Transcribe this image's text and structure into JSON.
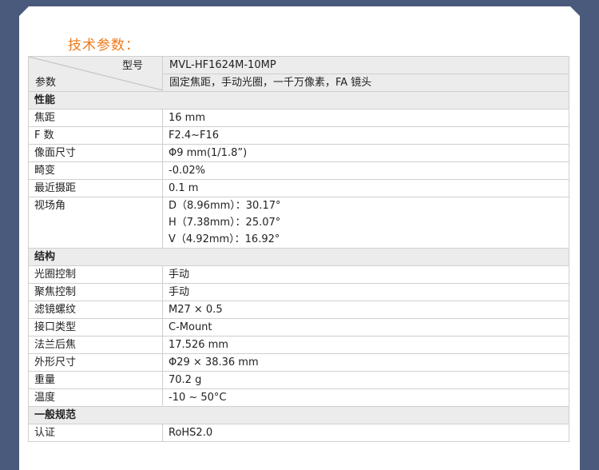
{
  "title": "技术参数：",
  "colors": {
    "accent": "#ee7a1a",
    "background": "#4a5a7c",
    "header_bg": "#ececec"
  },
  "header": {
    "model_label": "型号",
    "model_value": "MVL-HF1624M-10MP",
    "param_label": "参数",
    "param_value": "固定焦距，手动光圈，一千万像素，FA 镜头"
  },
  "sections": [
    {
      "title": "性能",
      "rows": [
        {
          "label": "焦距",
          "value": "16 mm"
        },
        {
          "label": "F 数",
          "value": "F2.4~F16"
        },
        {
          "label": "像面尺寸",
          "value": "Φ9 mm(1/1.8”)"
        },
        {
          "label": "畸变",
          "value": "-0.02%"
        },
        {
          "label": "最近摄距",
          "value": "0.1 m"
        }
      ],
      "fov": {
        "label": "视场角",
        "lines": [
          "D（8.96mm）：30.17°",
          "H（7.38mm）：25.07°",
          "V（4.92mm）：16.92°"
        ]
      }
    },
    {
      "title": "结构",
      "rows": [
        {
          "label": "光圈控制",
          "value": "手动"
        },
        {
          "label": "聚焦控制",
          "value": "手动"
        },
        {
          "label": "滤镜螺纹",
          "value": "M27 × 0.5"
        },
        {
          "label": "接口类型",
          "value": "C-Mount"
        },
        {
          "label": "法兰后焦",
          "value": "17.526 mm"
        },
        {
          "label": "外形尺寸",
          "value": "Φ29 × 38.36 mm"
        },
        {
          "label": "重量",
          "value": "70.2 g"
        },
        {
          "label": "温度",
          "value": "-10 ~ 50°C"
        }
      ]
    },
    {
      "title": "一般规范",
      "rows": [
        {
          "label": "认证",
          "value": "RoHS2.0"
        }
      ]
    }
  ]
}
